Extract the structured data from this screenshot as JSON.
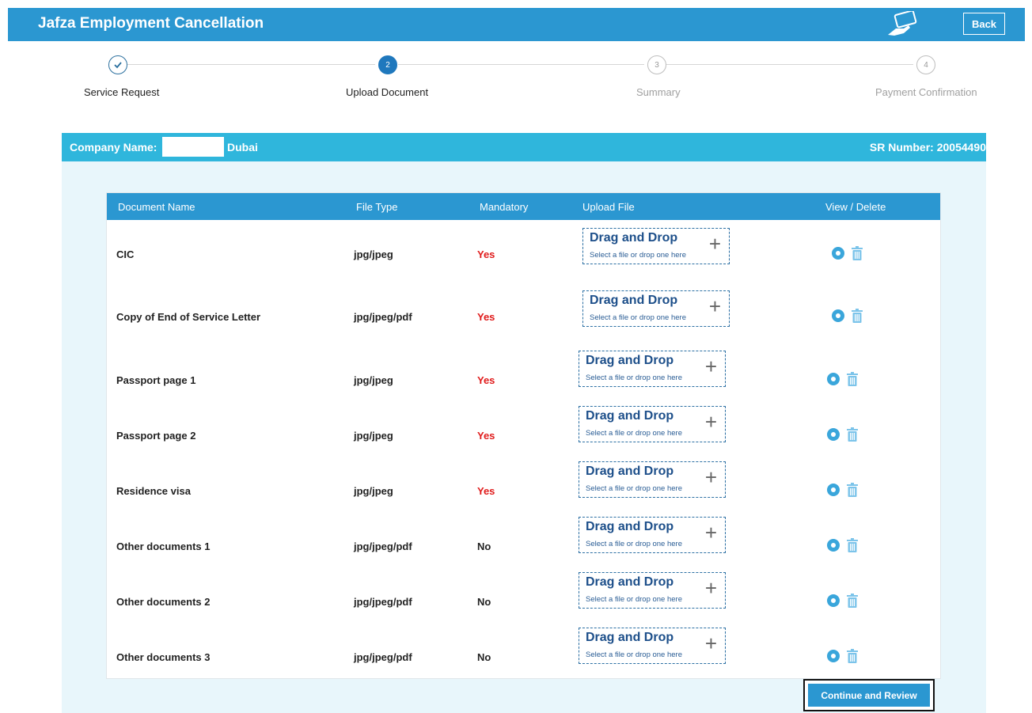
{
  "header": {
    "title": "Jafza Employment Cancellation",
    "logo_icon": "card-hand-icon",
    "back_label": "Back"
  },
  "stepper": {
    "steps": [
      {
        "number": "1",
        "label": "Service Request",
        "state": "done"
      },
      {
        "number": "2",
        "label": "Upload Document",
        "state": "active"
      },
      {
        "number": "3",
        "label": "Summary",
        "state": "todo"
      },
      {
        "number": "4",
        "label": "Payment Confirmation",
        "state": "todo"
      }
    ]
  },
  "company": {
    "label": "Company Name:",
    "city": "Dubai",
    "sr_number": "SR Number: 20054490"
  },
  "table": {
    "columns": [
      "Document Name",
      "File Type",
      "Mandatory",
      "Upload File",
      "View / Delete"
    ],
    "dropzone": {
      "title": "Drag and Drop",
      "subtitle": "Select a file or drop one here",
      "plus": "+"
    },
    "rows": [
      {
        "name": "CIC",
        "file_type": "jpg/jpeg",
        "mandatory": "Yes"
      },
      {
        "name": "Copy of End of Service Letter",
        "file_type": "jpg/jpeg/pdf",
        "mandatory": "Yes"
      },
      {
        "name": "Passport page 1",
        "file_type": "jpg/jpeg",
        "mandatory": "Yes"
      },
      {
        "name": "Passport page 2",
        "file_type": "jpg/jpeg",
        "mandatory": "Yes"
      },
      {
        "name": "Residence visa",
        "file_type": "jpg/jpeg",
        "mandatory": "Yes"
      },
      {
        "name": "Other documents 1",
        "file_type": "jpg/jpeg/pdf",
        "mandatory": "No"
      },
      {
        "name": "Other documents 2",
        "file_type": "jpg/jpeg/pdf",
        "mandatory": "No"
      },
      {
        "name": "Other documents 3",
        "file_type": "jpg/jpeg/pdf",
        "mandatory": "No"
      }
    ]
  },
  "actions": {
    "continue_label": "Continue and Review"
  },
  "colors": {
    "header": "#2b97d1",
    "company_bar": "#2fb6dc",
    "panel_bg": "#e8f6fb",
    "mandatory_yes": "#e01b1b",
    "dropzone_text": "#1d4f8a"
  }
}
